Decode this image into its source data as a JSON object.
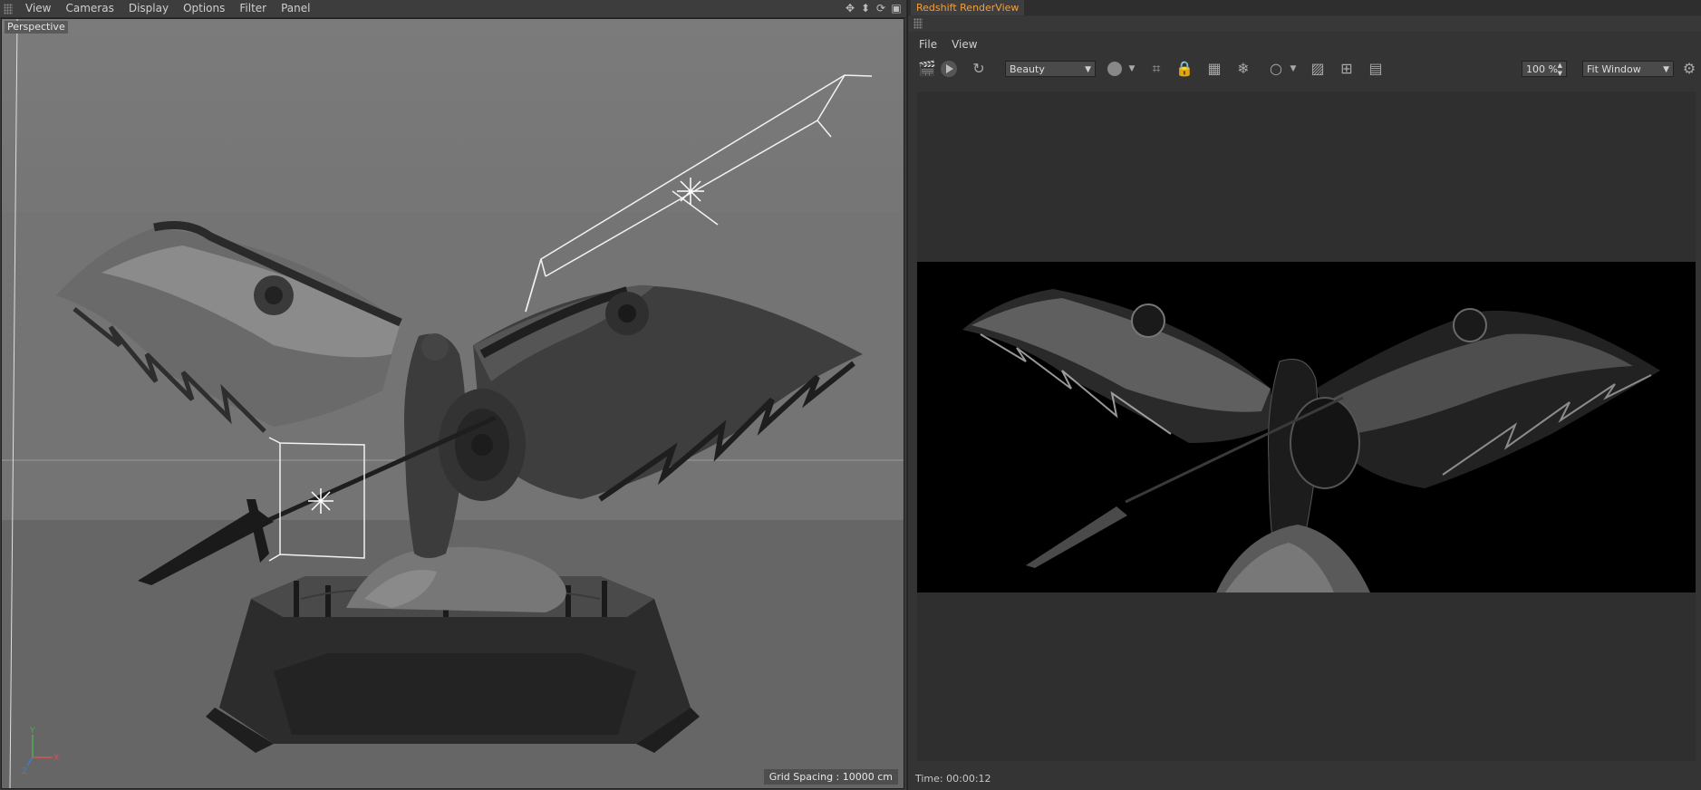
{
  "viewport": {
    "menu": [
      "View",
      "Cameras",
      "Display",
      "Options",
      "Filter",
      "Panel"
    ],
    "label": "Perspective",
    "grid_spacing": "Grid Spacing : 10000 cm",
    "axis_labels": {
      "x": "X",
      "y": "Y",
      "z": "Z"
    },
    "nav_icons": [
      "move-view-icon",
      "dolly-view-icon",
      "rotate-view-icon",
      "maximize-view-icon"
    ]
  },
  "render_view": {
    "title": "Redshift RenderView",
    "menu": [
      "File",
      "View"
    ],
    "aov_select": "Beauty",
    "zoom": "100 %",
    "fit_select": "Fit Window",
    "status": "Time: 00:00:12",
    "toolbar_icons": [
      "clapper-icon",
      "play-render-icon",
      "refresh-icon",
      "rgb-icon",
      "crop-icon",
      "lock-icon",
      "grid-icon",
      "snowflake-icon",
      "circle-icon",
      "image-icon",
      "add-snapshot-icon",
      "pv-icon",
      "gear-icon"
    ]
  },
  "colors": {
    "title_accent": "#f0a040",
    "viewport_bg": "#727272",
    "render_bg": "#000000"
  }
}
